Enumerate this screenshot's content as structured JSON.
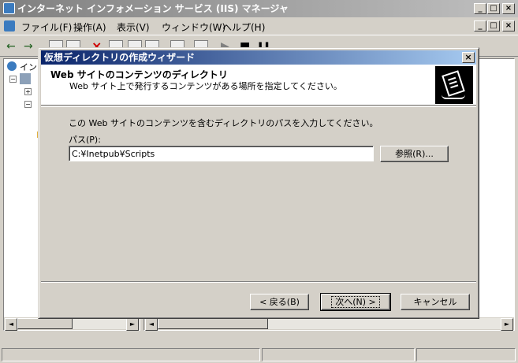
{
  "window": {
    "title": "インターネット インフォメーション サービス (IIS) マネージャ",
    "min": "_",
    "max": "□",
    "close": "×"
  },
  "menu": [
    "ファイル(F)",
    "操作(A)",
    "表示(V)",
    "ウィンドウ(W)",
    "ヘルプ(H)"
  ],
  "tree": {
    "root_label": "イン"
  },
  "dialog": {
    "title": "仮想ディレクトリの作成ウィザード",
    "close": "×",
    "header_title": "Web サイトのコンテンツのディレクトリ",
    "header_subtitle": "Web サイト上で発行するコンテンツがある場所を指定してください。",
    "instruction": "この Web サイトのコンテンツを含むディレクトリのパスを入力してください。",
    "path_label": "パス(P):",
    "path_value": "C:¥Inetpub¥Scripts",
    "browse_button": "参照(R)...",
    "back_button": "< 戻る(B)",
    "next_button": "次へ(N) >",
    "cancel_button": "キャンセル"
  },
  "icons": {
    "back_arrow": "←",
    "forward_arrow": "→",
    "scroll_left": "◄",
    "scroll_right": "►",
    "play": "▶",
    "stop": "■",
    "pause": "❚❚"
  }
}
